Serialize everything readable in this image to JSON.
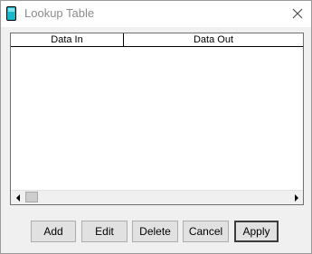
{
  "window": {
    "title": "Lookup Table",
    "app_icon": "device-icon",
    "close_icon": "close-icon"
  },
  "table": {
    "columns": [
      "Data In",
      "Data Out"
    ],
    "rows": []
  },
  "scrollbar": {
    "left_icon": "triangle-left-icon",
    "right_icon": "triangle-right-icon"
  },
  "buttons": {
    "add": "Add",
    "edit": "Edit",
    "delete": "Delete",
    "cancel": "Cancel",
    "apply": "Apply"
  }
}
